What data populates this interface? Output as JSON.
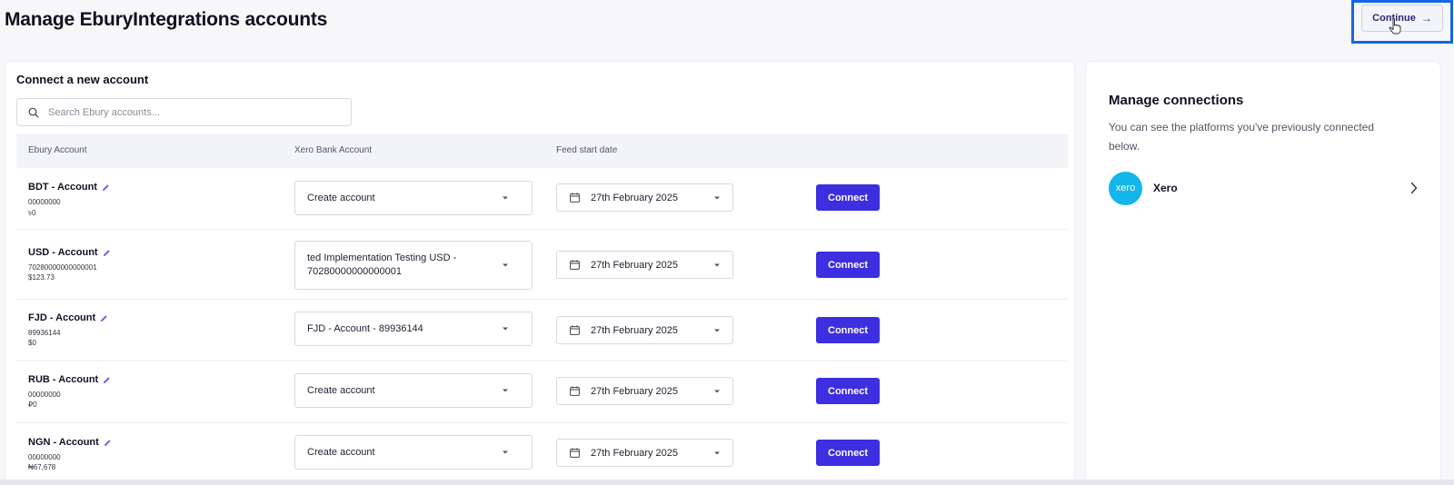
{
  "page": {
    "title": "Manage EburyIntegrations accounts"
  },
  "toolbar": {
    "continue_label": "Continue",
    "continue_arrow": "→"
  },
  "connect": {
    "heading": "Connect a new account",
    "search_placeholder": "Search Ebury accounts...",
    "columns": {
      "ebury_account": "Ebury Account",
      "xero_bank_account": "Xero Bank Account",
      "feed_start_date": "Feed start date"
    },
    "connect_label": "Connect",
    "rows": [
      {
        "name": "BDT - Account",
        "number": "00000000",
        "balance": "৳0",
        "xero_account": "Create account",
        "date": "27th February 2025"
      },
      {
        "name": "USD - Account",
        "number": "70280000000000001",
        "balance": "$123.73",
        "xero_account": "ted Implementation Testing USD - 70280000000000001",
        "date": "27th February 2025"
      },
      {
        "name": "FJD - Account",
        "number": "89936144",
        "balance": "$0",
        "xero_account": "FJD - Account - 89936144",
        "date": "27th February 2025"
      },
      {
        "name": "RUB - Account",
        "number": "00000000",
        "balance": "₽0",
        "xero_account": "Create account",
        "date": "27th February 2025"
      },
      {
        "name": "NGN - Account",
        "number": "00000000",
        "balance": "₦67,678",
        "xero_account": "Create account",
        "date": "27th February 2025"
      }
    ]
  },
  "manage": {
    "title": "Manage connections",
    "description": "You can see the platforms you've previously connected below.",
    "platforms": [
      {
        "logo_text": "xero",
        "name": "Xero"
      }
    ]
  },
  "colors": {
    "accent": "#3d2ee0",
    "highlight": "#1565e8",
    "xero": "#13b5ea"
  },
  "icons": {
    "search": "search-icon",
    "edit": "pencil-icon",
    "calendar": "calendar-icon",
    "caret": "chevron-down-icon",
    "chevron_right": "chevron-right-icon",
    "cursor": "hand-cursor-icon"
  }
}
